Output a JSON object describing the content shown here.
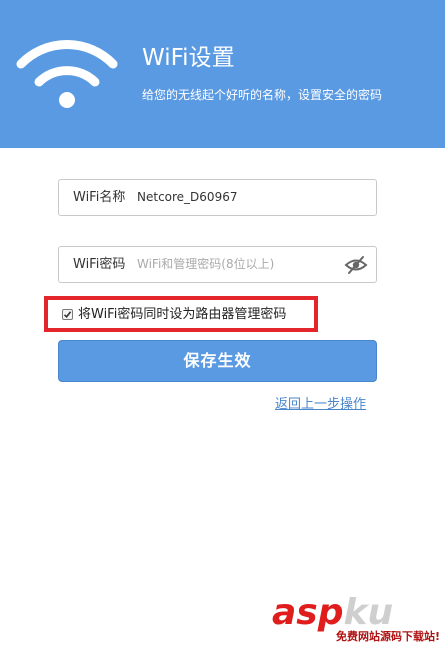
{
  "header": {
    "title": "WiFi设置",
    "subtitle": "给您的无线起个好听的名称，设置安全的密码",
    "background_color": "#5a9ae3"
  },
  "wifi_name_field": {
    "label": "WiFi名称",
    "value": "Netcore_D60967"
  },
  "wifi_password_field": {
    "label": "WiFi密码",
    "placeholder": "WiFi和管理密码(8位以上)",
    "toggle_icon": "eye-slash-icon"
  },
  "sync_admin_checkbox": {
    "label": "将WiFi密码同时设为路由器管理密码",
    "checked": true,
    "highlight_color": "#e3262c"
  },
  "save_button": {
    "label": "保存生效"
  },
  "back_link": {
    "label": "返回上一步操作"
  },
  "watermark": {
    "main_asp": "asp",
    "main_ku": "ku",
    "tagline": "免费网站源码下载站!"
  }
}
